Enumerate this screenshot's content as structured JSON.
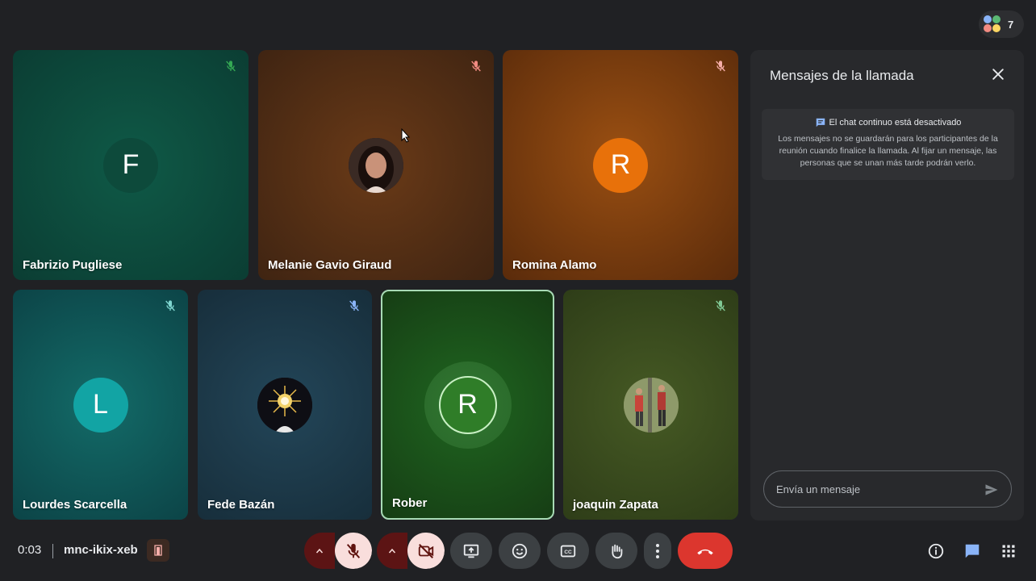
{
  "people": {
    "count": "7"
  },
  "participants": [
    {
      "name": "Fabrizio Pugliese",
      "initial": "F",
      "muted": true
    },
    {
      "name": "Melanie Gavio Giraud",
      "initial": "",
      "muted": true
    },
    {
      "name": "Romina Alamo",
      "initial": "R",
      "muted": true
    },
    {
      "name": "Lourdes Scarcella",
      "initial": "L",
      "muted": true
    },
    {
      "name": "Fede Bazán",
      "initial": "",
      "muted": true
    },
    {
      "name": "Rober",
      "initial": "R",
      "muted": false
    },
    {
      "name": "joaquin Zapata",
      "initial": "",
      "muted": true
    }
  ],
  "chat": {
    "title": "Mensajes de la llamada",
    "notice_title": "El chat continuo está desactivado",
    "notice_body": "Los mensajes no se guardarán para los participantes de la reunión cuando finalice la llamada. Al fijar un mensaje, las personas que se unan más tarde podrán verlo.",
    "input_placeholder": "Envía un mensaje"
  },
  "meeting": {
    "time": "0:03",
    "code": "mnc-ikix-xeb"
  },
  "icons": {
    "mic": "mic-off-icon",
    "camera": "camera-off-icon",
    "present": "present-screen-icon",
    "reactions": "emoji-icon",
    "captions": "captions-icon",
    "hand": "raise-hand-icon",
    "more": "more-vert-icon",
    "hangup": "call-end-icon",
    "info": "info-icon",
    "chat": "chat-icon",
    "activities": "apps-grid-icon"
  },
  "colors": {
    "hangup": "#dc362e",
    "active_speaker_border": "#a8dab5",
    "muted_control": "#f9dedc"
  }
}
